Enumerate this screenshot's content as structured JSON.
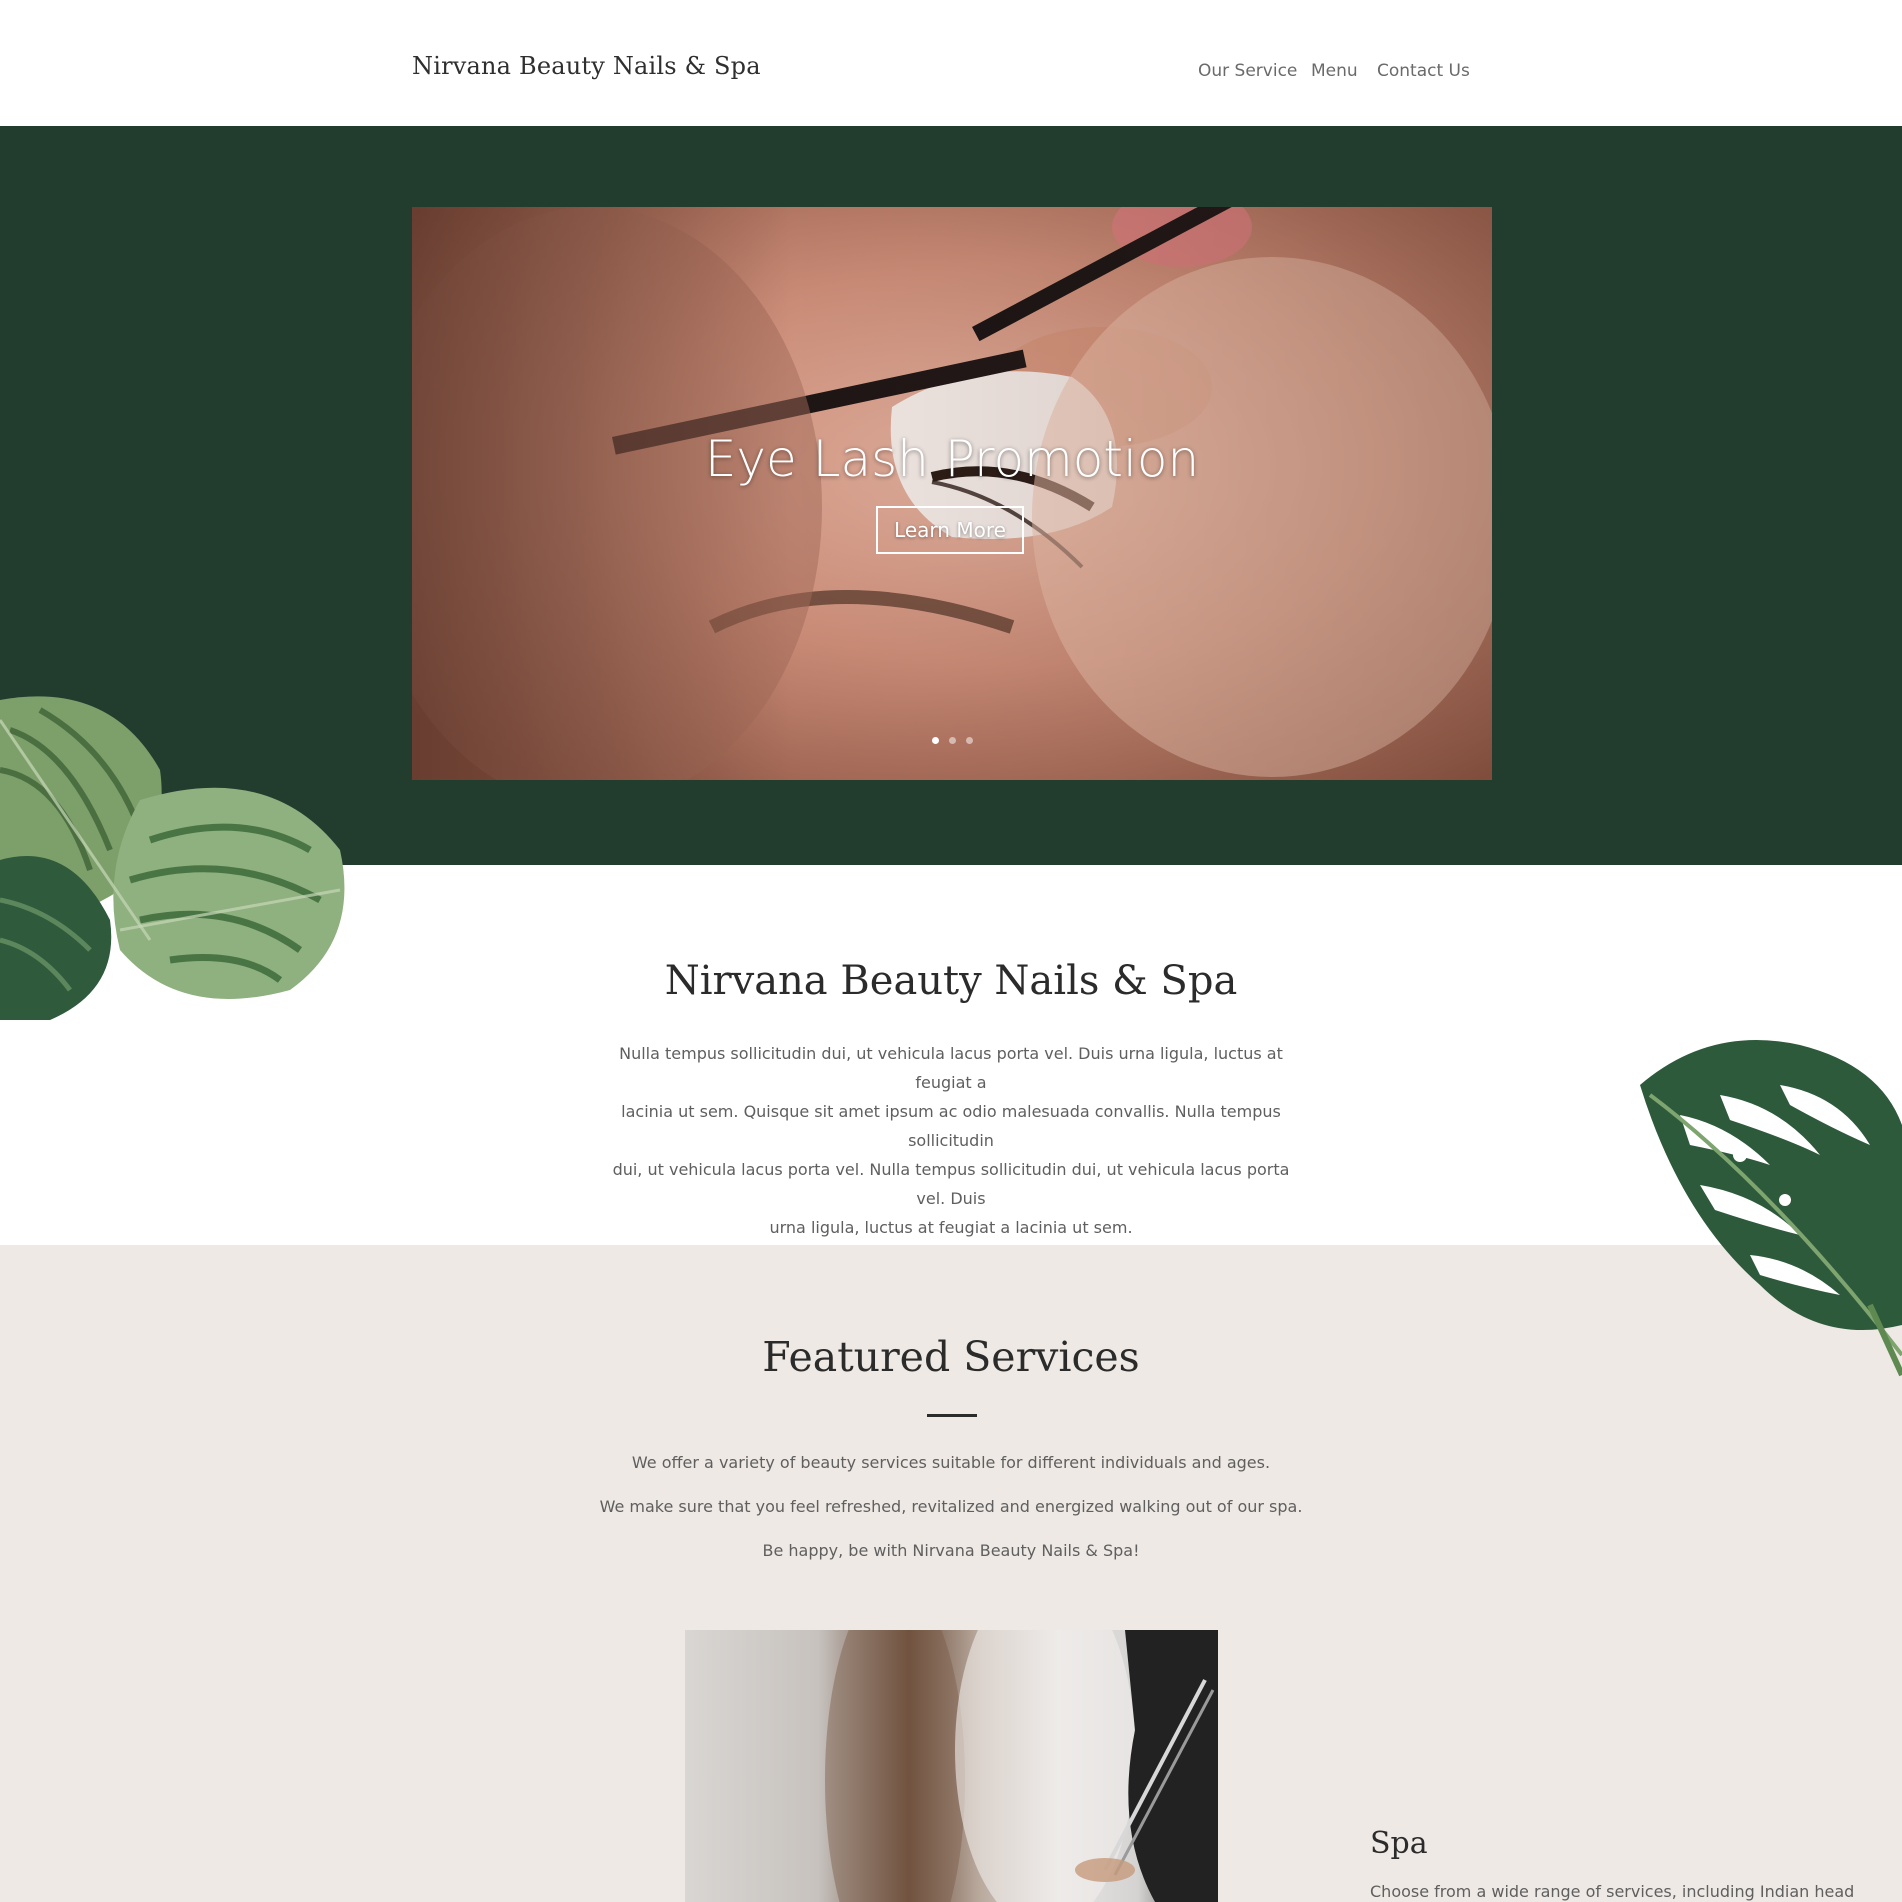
{
  "header": {
    "brand": "Nirvana Beauty Nails & Spa",
    "nav": [
      "Our Service",
      "Menu",
      "Contact Us"
    ]
  },
  "hero": {
    "title": "Eye Lash Promotion",
    "button": "Learn More",
    "slides_total": 3,
    "active_slide": 1
  },
  "intro": {
    "title": "Nirvana Beauty Nails & Spa",
    "lines": [
      "Nulla tempus sollicitudin dui, ut vehicula lacus porta vel. Duis urna ligula, luctus at feugiat a",
      "lacinia ut sem. Quisque sit amet ipsum ac odio malesuada convallis. Nulla tempus sollicitudin",
      "dui, ut vehicula lacus porta vel.  Nulla tempus sollicitudin dui, ut vehicula lacus porta vel. Duis",
      "urna ligula, luctus at feugiat a lacinia ut sem."
    ]
  },
  "featured": {
    "title": "Featured Services",
    "lines": [
      "We offer a variety of beauty services suitable for different individuals and ages.",
      "We make sure that you feel refreshed, revitalized and energized walking out of our spa.",
      "Be happy, be with Nirvana Beauty Nails & Spa!"
    ],
    "service": {
      "title": "Spa",
      "description": "Choose from a wide range of services, including Indian head"
    }
  },
  "colors": {
    "hero_bg": "#223d2e",
    "featured_bg": "#eee9e4",
    "text_dark": "#2b2b2b",
    "text_muted": "#5f5f5f"
  }
}
